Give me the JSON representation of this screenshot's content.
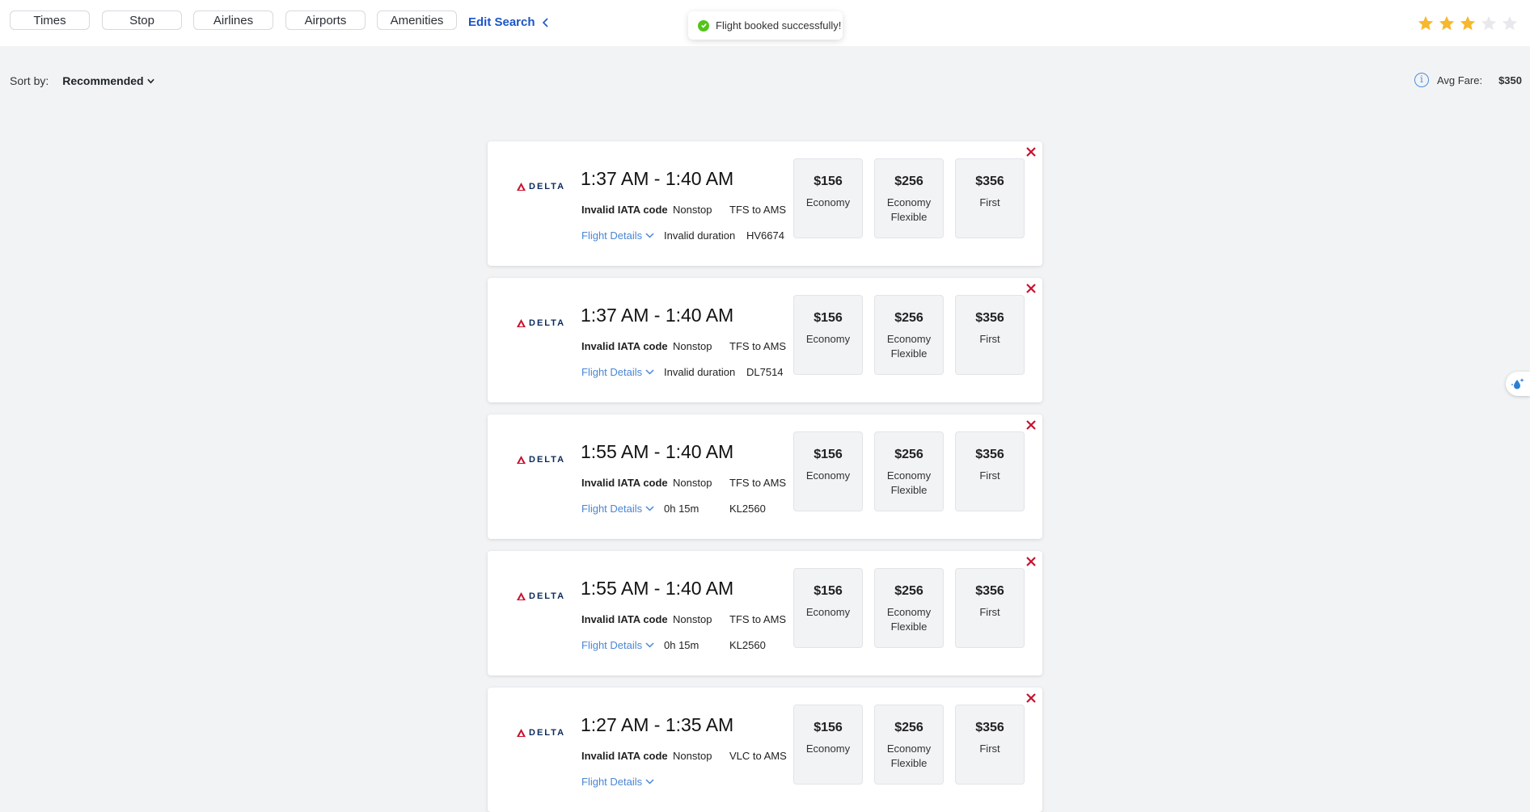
{
  "filters": [
    "Times",
    "Stop",
    "Airlines",
    "Airports",
    "Amenities"
  ],
  "edit_search": "Edit Search",
  "toast": "Flight booked successfully!",
  "rating": {
    "filled": 3,
    "total": 5
  },
  "sort": {
    "label": "Sort by:",
    "value": "Recommended"
  },
  "avg_fare": {
    "label": "Avg Fare:",
    "value": "$350"
  },
  "colors": {
    "accent": "#1a56c8",
    "link": "#4a86d4",
    "close": "#c8102e",
    "star": "#f5b82e",
    "success": "#52c41a"
  },
  "flights": [
    {
      "airline": "DELTA",
      "times": "1:37 AM - 1:40 AM",
      "airport": "Invalid IATA code",
      "stops": "Nonstop",
      "route": "TFS to AMS",
      "details": "Flight Details",
      "duration": "Invalid duration",
      "flight_no": "HV6674",
      "fares": [
        {
          "price": "$156",
          "cls": "Economy"
        },
        {
          "price": "$256",
          "cls": "Economy Flexible"
        },
        {
          "price": "$356",
          "cls": "First"
        }
      ]
    },
    {
      "airline": "DELTA",
      "times": "1:37 AM - 1:40 AM",
      "airport": "Invalid IATA code",
      "stops": "Nonstop",
      "route": "TFS to AMS",
      "details": "Flight Details",
      "duration": "Invalid duration",
      "flight_no": "DL7514",
      "fares": [
        {
          "price": "$156",
          "cls": "Economy"
        },
        {
          "price": "$256",
          "cls": "Economy Flexible"
        },
        {
          "price": "$356",
          "cls": "First"
        }
      ]
    },
    {
      "airline": "DELTA",
      "times": "1:55 AM - 1:40 AM",
      "airport": "Invalid IATA code",
      "stops": "Nonstop",
      "route": "TFS to AMS",
      "details": "Flight Details",
      "duration": "0h 15m",
      "flight_no": "KL2560",
      "fares": [
        {
          "price": "$156",
          "cls": "Economy"
        },
        {
          "price": "$256",
          "cls": "Economy Flexible"
        },
        {
          "price": "$356",
          "cls": "First"
        }
      ]
    },
    {
      "airline": "DELTA",
      "times": "1:55 AM - 1:40 AM",
      "airport": "Invalid IATA code",
      "stops": "Nonstop",
      "route": "TFS to AMS",
      "details": "Flight Details",
      "duration": "0h 15m",
      "flight_no": "KL2560",
      "fares": [
        {
          "price": "$156",
          "cls": "Economy"
        },
        {
          "price": "$256",
          "cls": "Economy Flexible"
        },
        {
          "price": "$356",
          "cls": "First"
        }
      ]
    },
    {
      "airline": "DELTA",
      "times": "1:27 AM - 1:35 AM",
      "airport": "Invalid IATA code",
      "stops": "Nonstop",
      "route": "VLC to AMS",
      "details": "Flight Details",
      "duration": "",
      "flight_no": "",
      "fares": [
        {
          "price": "$156",
          "cls": "Economy"
        },
        {
          "price": "$256",
          "cls": "Economy Flexible"
        },
        {
          "price": "$356",
          "cls": "First"
        }
      ]
    }
  ]
}
